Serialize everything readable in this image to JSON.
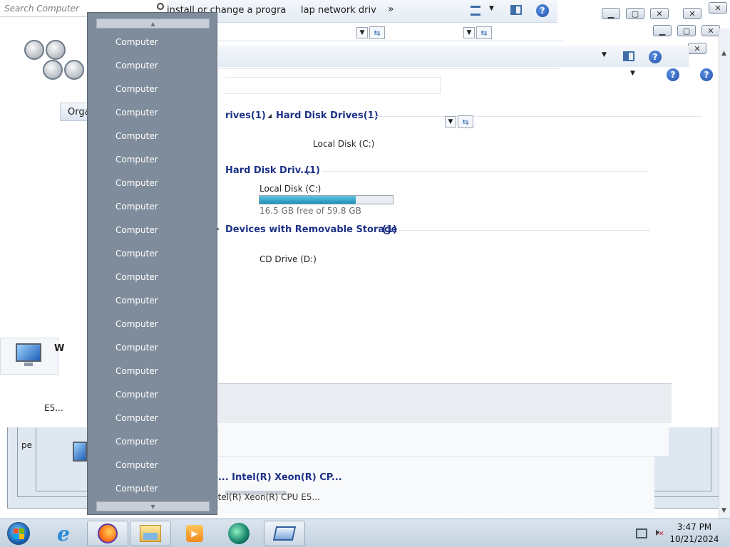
{
  "search": {
    "placeholder": "Search Computer"
  },
  "toolbar": {
    "install_label": "install or change a progra",
    "map_label": "lap network driv",
    "more_label": "»"
  },
  "organize": {
    "label": "Orga"
  },
  "groups": {
    "hard_disk_a": "rives(1)",
    "hard_disk_b": "Hard Disk Drives(1)",
    "hard_disk_c": "Hard Disk Driv...",
    "hard_disk_c_count": "(1)",
    "removable": "Devices with Removable Storage",
    "removable_count": "(1)"
  },
  "drives": {
    "local_disk_top": "Local Disk (C:)",
    "local_disk": "Local Disk (C:)",
    "local_disk_free": "16.5 GB free of 59.8 GB",
    "local_disk_used_fraction": 0.72,
    "cd_drive": "CD Drive (D:)"
  },
  "details": {
    "processor_label": "e... Intel(R) Xeon(R) CP...",
    "processor_sub": "ntel(R) Xeon(R) CPU E5...",
    "left_fragment": "E5...",
    "left_letter": "W",
    "left_pe": "pe"
  },
  "dropdown": {
    "items": [
      "Computer",
      "Computer",
      "Computer",
      "Computer",
      "Computer",
      "Computer",
      "Computer",
      "Computer",
      "Computer",
      "Computer",
      "Computer",
      "Computer",
      "Computer",
      "Computer",
      "Computer",
      "Computer",
      "Computer",
      "Computer",
      "Computer",
      "Computer"
    ],
    "scroll_up": "▲",
    "scroll_down": "▼"
  },
  "taskbar": {
    "time": "3:47 PM",
    "date": "10/21/2024",
    "apps": [
      "start-orb",
      "internet-explorer-icon",
      "firefox-icon",
      "file-explorer-icon",
      "media-player-icon",
      "network-app-icon",
      "remote-display-icon"
    ]
  },
  "colors": {
    "dropdown_bg": "#7f8c9b",
    "header_blue": "#1e3287",
    "progress_fill": "#2ea3c9"
  }
}
